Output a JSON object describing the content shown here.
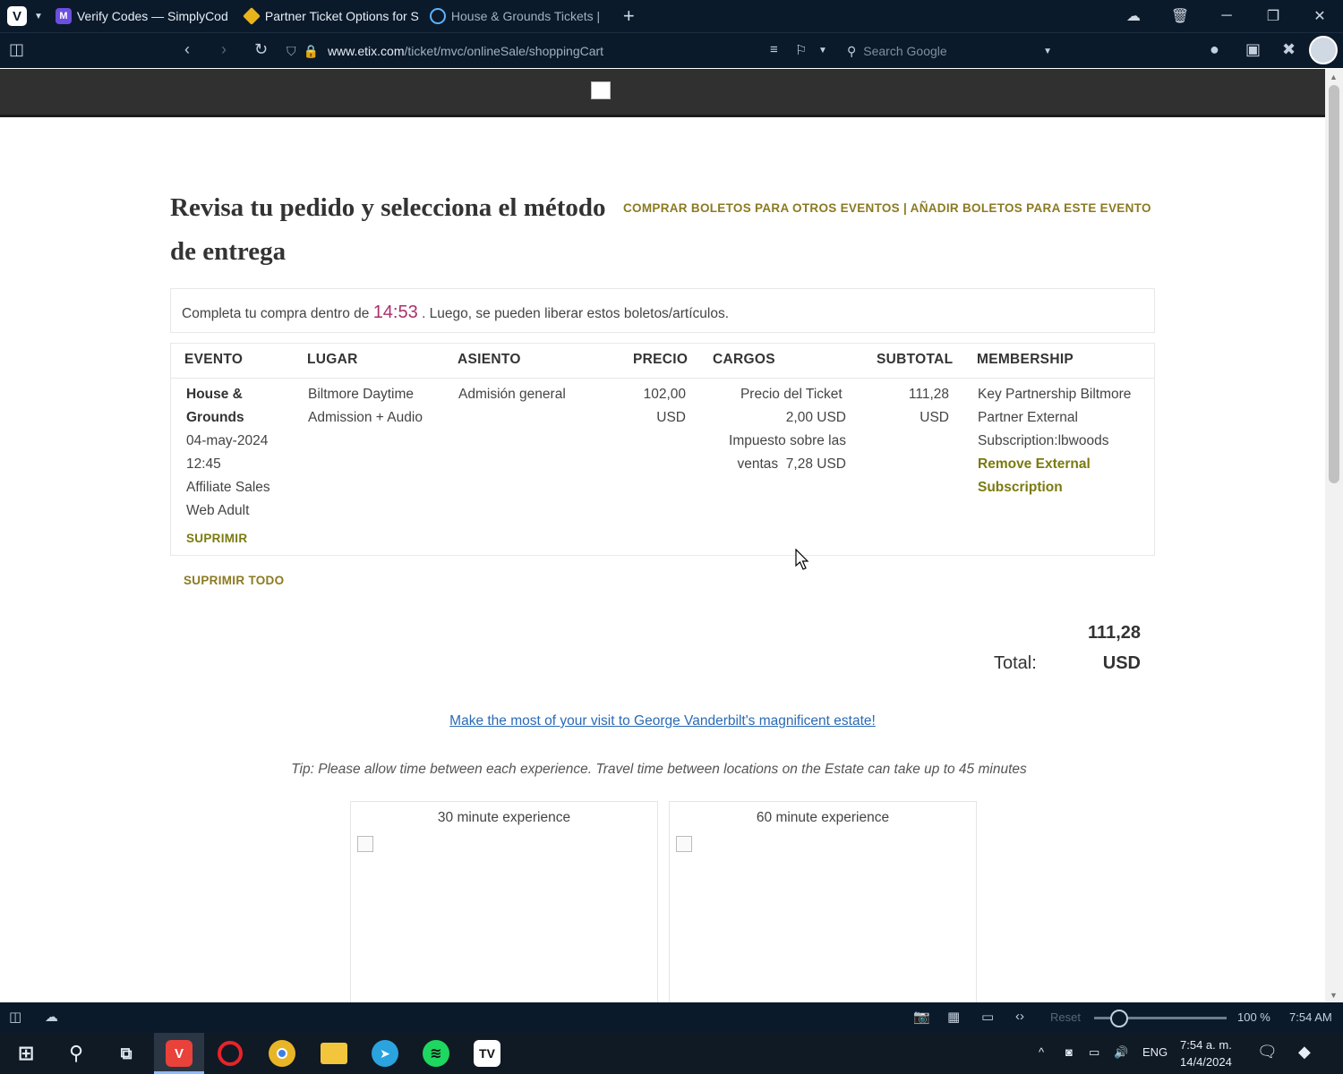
{
  "browser": {
    "tabs": [
      {
        "title": "Verify Codes — SimplyCod"
      },
      {
        "title": "Partner Ticket Options for S"
      },
      {
        "title": "House & Grounds Tickets | "
      }
    ],
    "url_host": "www.etix.com",
    "url_path": "/ticket/mvc/onlineSale/shoppingCart",
    "search_placeholder": "Search Google"
  },
  "page": {
    "title": "Revisa tu pedido y selecciona el método de entrega",
    "links": "COMPRAR BOLETOS PARA OTROS EVENTOS | AÑADIR BOLETOS PARA ESTE EVENTO",
    "timer": {
      "prefix": "Completa tu compra dentro de",
      "time": "14:53",
      "suffix": ". Luego, se pueden liberar estos boletos/artículos."
    },
    "table": {
      "headers": {
        "evento": "EVENTO",
        "lugar": "LUGAR",
        "asiento": "ASIENTO",
        "precio": "PRECIO",
        "cargos": "CARGOS",
        "subtotal": "SUBTOTAL",
        "membership": "MEMBERSHIP"
      },
      "row": {
        "event_name": "House & Grounds",
        "event_date": "04-may-2024",
        "event_time": "12:45",
        "event_type": "Affiliate Sales Web Adult",
        "lugar": "Biltmore Daytime Admission + Audio",
        "asiento": "Admisión general",
        "precio_amount": "102,00",
        "precio_currency": "USD",
        "fee1_label": "Precio del Ticket",
        "fee1_value": "2,00 USD",
        "fee2_label": "Impuesto sobre las ventas",
        "fee2_value": "7,28 USD",
        "subtotal_amount": "111,28",
        "subtotal_currency": "USD",
        "membership_text": "Key Partnership Biltmore Partner External Subscription:lbwoods",
        "membership_link": "Remove External Subscription",
        "delete_label": "SUPRIMIR"
      }
    },
    "delete_all_label": "SUPRIMIR TODO",
    "total": {
      "amount": "111,28",
      "label": "Total:",
      "currency": "USD"
    },
    "promo_link": "Make the most of your visit to George Vanderbilt's magnificent estate!",
    "tip": "Tip: Please allow time between each experience. Travel time between locations on the Estate can take up to 45 minutes",
    "experiences": [
      {
        "title": "30 minute experience"
      },
      {
        "title": "60 minute experience"
      }
    ]
  },
  "statusbar": {
    "reset_label": "Reset",
    "zoom": "100 %",
    "time": "7:54 AM"
  },
  "taskbar": {
    "lang": "ENG",
    "time": "7:54 a. m.",
    "date": "14/4/2024"
  },
  "colors": {
    "browser_chrome": "#0b1a2a",
    "site_header": "#303030",
    "link_olive": "#8b7a22",
    "timer_accent": "#a8326a",
    "promo_link": "#2a6ab5"
  }
}
